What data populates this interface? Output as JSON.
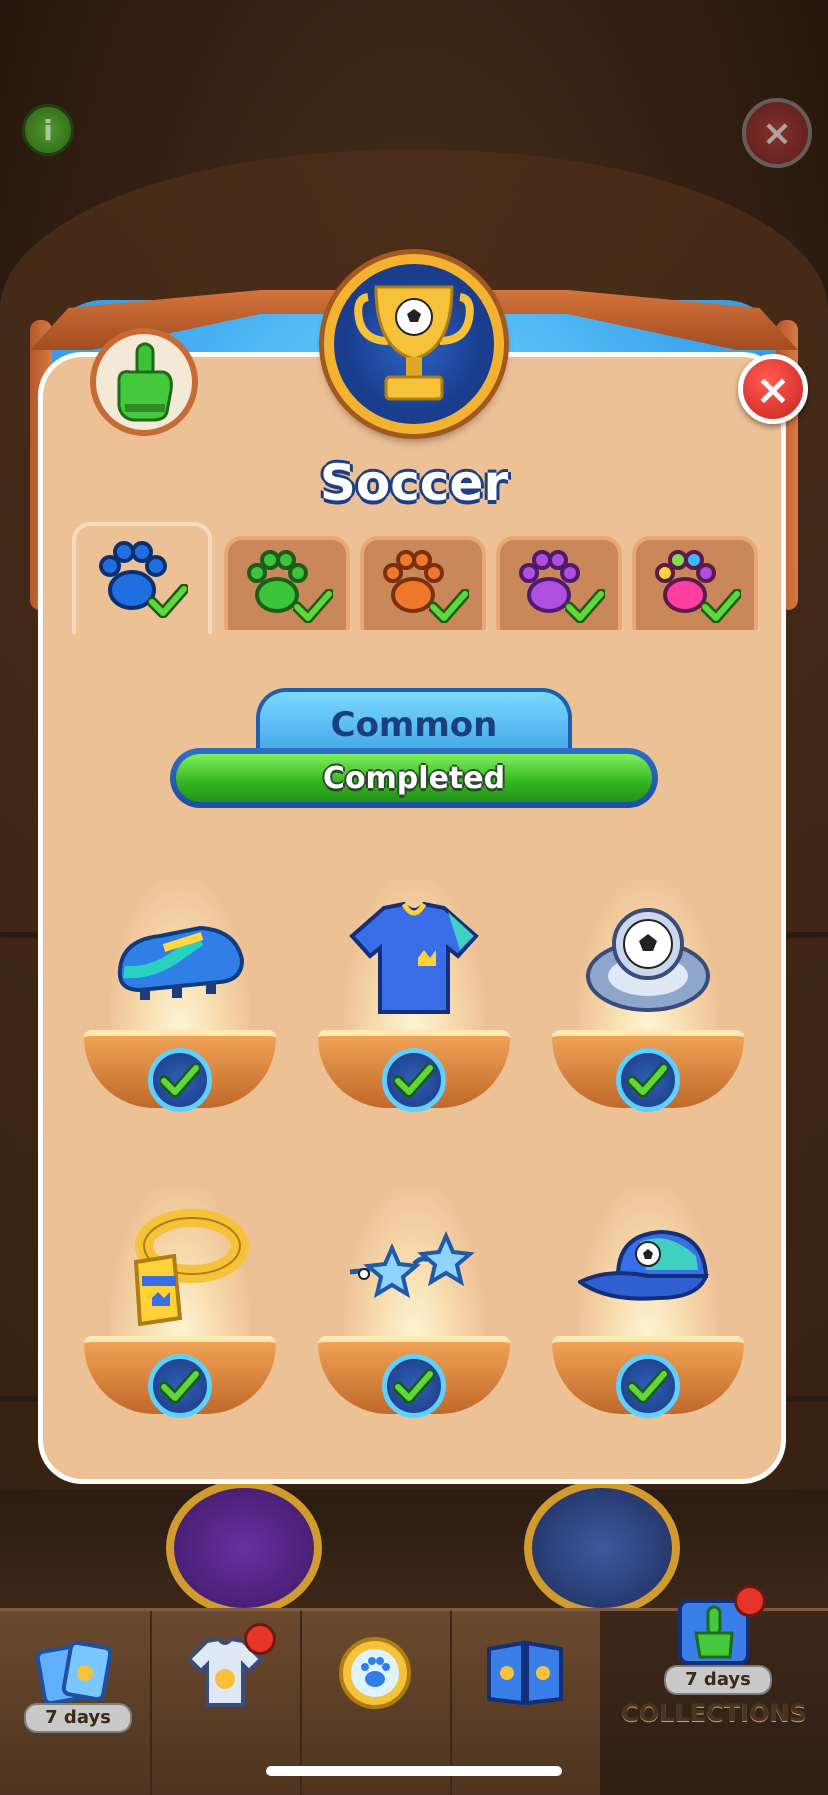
{
  "modal": {
    "title": "Soccer",
    "close_icon": "×",
    "rarity_label": "Common",
    "progress_label": "Completed",
    "progress": 1.0
  },
  "tabs": [
    {
      "name": "blue-paw",
      "color": "#1f6fe0",
      "completed": true,
      "active": true
    },
    {
      "name": "green-paw",
      "color": "#3cc43a",
      "completed": true,
      "active": false
    },
    {
      "name": "orange-paw",
      "color": "#f0782a",
      "completed": true,
      "active": false
    },
    {
      "name": "purple-paw",
      "color": "#b04ee0",
      "completed": true,
      "active": false
    },
    {
      "name": "rainbow-paw",
      "color": "#ff3fa0",
      "completed": true,
      "active": false
    }
  ],
  "items": [
    {
      "name": "soccer-cleat",
      "collected": true
    },
    {
      "name": "jersey",
      "collected": true
    },
    {
      "name": "soccer-ring",
      "collected": true
    },
    {
      "name": "scarf",
      "collected": true
    },
    {
      "name": "star-glasses",
      "collected": true
    },
    {
      "name": "cap",
      "collected": true
    }
  ],
  "background": {
    "info_icon": "i",
    "close_icon": "×"
  },
  "nav": {
    "items": [
      {
        "name": "events-cards",
        "days": "7 days"
      },
      {
        "name": "jersey-shop",
        "badge": true
      },
      {
        "name": "paw-coin"
      },
      {
        "name": "cards-album"
      },
      {
        "name": "collections",
        "days": "7 days",
        "label": "COLLECTIONS",
        "badge": true,
        "active": true
      }
    ]
  }
}
